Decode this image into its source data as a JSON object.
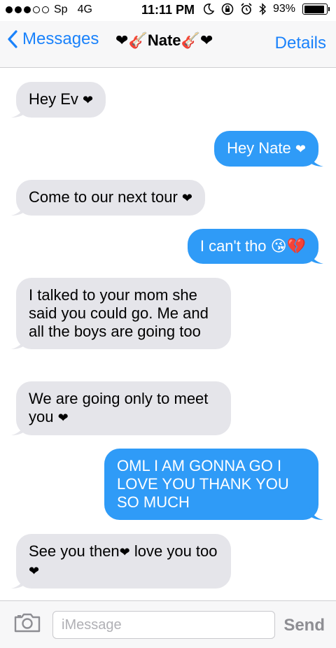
{
  "status_bar": {
    "carrier": "Sp",
    "network": "4G",
    "time": "11:11 PM",
    "battery": "93%",
    "battery_level": 0.93,
    "signal_bars_filled": 3,
    "signal_bars_total": 5
  },
  "nav": {
    "back_label": "Messages",
    "contact_name": "Nate",
    "details_label": "Details"
  },
  "messages": [
    {
      "from": "contact",
      "text": "Hey Ev",
      "emoji": "❤"
    },
    {
      "from": "me",
      "text": "Hey Nate",
      "emoji": "❤"
    },
    {
      "from": "contact",
      "text": "Come to our next tour",
      "emoji": "❤"
    },
    {
      "from": "me",
      "text": "I can't tho",
      "emoji": "😘💔"
    },
    {
      "from": "contact",
      "text": "I talked to your mom she said you could go. Me and all the boys are going too"
    },
    {
      "from": "contact",
      "text": "We are going only to meet you",
      "emoji": "❤"
    },
    {
      "from": "me",
      "text": "OML I AM GONNA GO I LOVE YOU THANK YOU SO MUCH"
    },
    {
      "from": "contact",
      "text": "See you then",
      "emoji": "❤",
      "text2": " love you too",
      "emoji2": "❤"
    }
  ],
  "input": {
    "placeholder": "iMessage",
    "value": "",
    "send_label": "Send"
  },
  "colors": {
    "accent": "#1a82fb",
    "outgoing_bubble": "#2f9bf7",
    "incoming_bubble": "#e5e5ea"
  }
}
